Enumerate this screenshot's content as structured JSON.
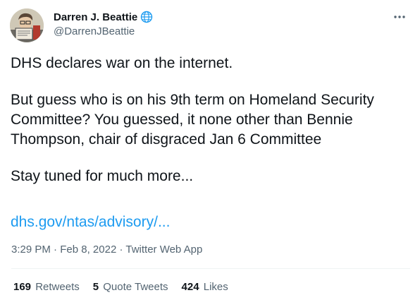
{
  "author": {
    "display_name": "Darren J. Beattie",
    "handle": "@DarrenJBeattie",
    "verified_icon": "globe-icon",
    "more_icon": "more-horizontal-icon"
  },
  "tweet": {
    "paragraphs": [
      "DHS declares war on the internet.",
      "But guess who is on his 9th term on Homeland Security",
      "Committee? You guessed, it none other than Bennie",
      "Thompson, chair of disgraced Jan 6 Committee",
      "Stay tuned for much more..."
    ],
    "link_text": "dhs.gov/ntas/advisory/..."
  },
  "meta": {
    "time": "3:29 PM",
    "separator": "·",
    "date": "Feb 8, 2022",
    "source": "Twitter Web App"
  },
  "stats": {
    "retweets_count": "169",
    "retweets_label": "Retweets",
    "quotes_count": "5",
    "quotes_label": "Quote Tweets",
    "likes_count": "424",
    "likes_label": "Likes"
  },
  "colors": {
    "text": "#0f1419",
    "secondary": "#536471",
    "link": "#1d9bf0",
    "divider": "#eff3f4"
  }
}
